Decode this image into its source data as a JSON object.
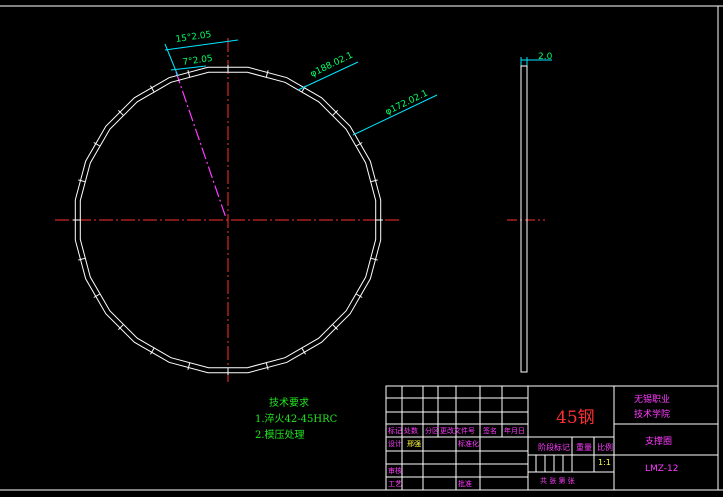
{
  "dimensions": {
    "angle_outer": "15°2.05",
    "angle_inner": "7°2.05",
    "dia_outer": "φ188.02.1",
    "dia_inner": "φ172.02.1",
    "thickness": "2.0"
  },
  "notes": {
    "heading": "技术要求",
    "items": [
      "1.淬火42-45HRC",
      "2.模压处理"
    ]
  },
  "title_block": {
    "material": "45钢",
    "school": [
      "无锡职业",
      "技术学院"
    ],
    "part_name": "支撑圈",
    "drawing_no": "LMZ-12",
    "scale": "1:1",
    "headers": [
      "标记",
      "处数",
      "分区",
      "更改文件号",
      "签名",
      "年月日"
    ],
    "design_label": "设计",
    "designer": "邢强",
    "standard_label": "标准化",
    "stage_label": "阶段标记",
    "weight_label": "重量",
    "scale_label": "比例",
    "review_label": "审核",
    "process_label": "工艺",
    "approve_label": "批准",
    "sheets": "共  张  第  张"
  },
  "colors": {
    "background": "#000000",
    "outline": "#ffffff",
    "center_line": "#ff3030",
    "dimension": "#00e5ff",
    "dim_text": "#00ff66",
    "notes": "#22e422",
    "material": "#ff3030",
    "label": "#ff3cff",
    "value": "#ffff40",
    "inclined_axis": "#ff3cff"
  }
}
